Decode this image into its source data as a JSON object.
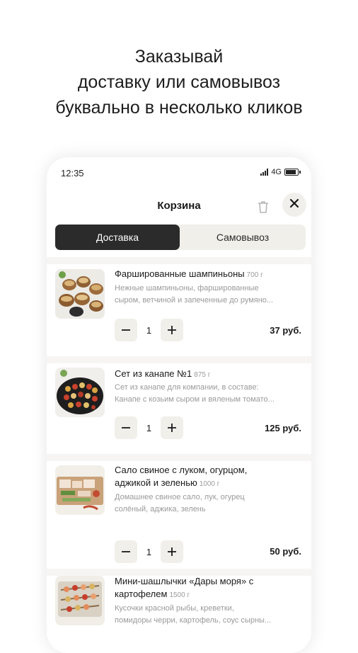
{
  "headline": {
    "line1": "Заказывай",
    "line2": "доставку или самовывоз",
    "line3": "буквально в несколько кликов"
  },
  "status_bar": {
    "time": "12:35",
    "network": "4G"
  },
  "header": {
    "title": "Корзина"
  },
  "tabs": [
    {
      "label": "Доставка",
      "active": true
    },
    {
      "label": "Самовывоз",
      "active": false
    }
  ],
  "items": [
    {
      "name": "Фаршированные шампиньоны",
      "weight": "700 г",
      "desc_line1": "Нежные шампиньоны, фаршированные",
      "desc_line2": "сыром, ветчиной и запеченные до румяно...",
      "qty": "1",
      "price": "37 руб."
    },
    {
      "name": "Сет из канапе №1",
      "weight": "875 г",
      "desc_line1": "Сет из канапе для компании, в составе:",
      "desc_line2": "Канапе с козьим сыром и вяленым томато...",
      "qty": "1",
      "price": "125 руб."
    },
    {
      "name_line1": "Сало свиное с луком, огурцом,",
      "name_line2": "аджикой и зеленью",
      "weight": "1000 г",
      "desc_line1": "Домашнее свиное сало, лук, огурец",
      "desc_line2": "солёный, аджика, зелень",
      "qty": "1",
      "price": "50 руб."
    },
    {
      "name_line1": "Мини-шашлычки «Дары моря» с",
      "name_line2": "картофелем",
      "weight": "1500 г",
      "desc_line1": "Кусочки красной рыбы, креветки,",
      "desc_line2": "помидоры черри, картофель, соус сырны..."
    }
  ],
  "colors": {
    "accent_dark": "#2b2b2b",
    "control_bg": "#f1efea"
  }
}
